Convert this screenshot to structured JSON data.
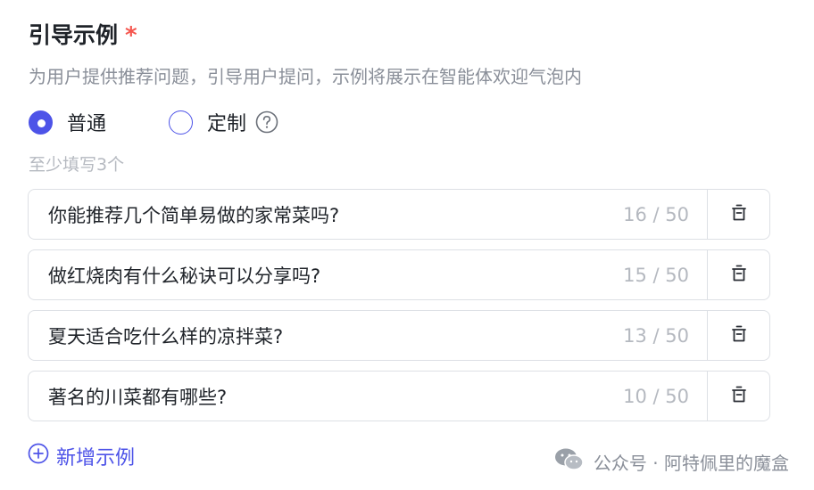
{
  "section": {
    "title": "引导示例",
    "required_mark": "*",
    "description": "为用户提供推荐问题，引导用户提问，示例将展示在智能体欢迎气泡内"
  },
  "mode": {
    "options": [
      {
        "label": "普通",
        "checked": true
      },
      {
        "label": "定制",
        "checked": false
      }
    ]
  },
  "hint": "至少填写3个",
  "examples": [
    {
      "text": "你能推荐几个简单易做的家常菜吗?",
      "count": "16 / 50"
    },
    {
      "text": "做红烧肉有什么秘诀可以分享吗?",
      "count": "15 / 50"
    },
    {
      "text": "夏天适合吃什么样的凉拌菜?",
      "count": "13 / 50"
    },
    {
      "text": "著名的川菜都有哪些?",
      "count": "10 / 50"
    }
  ],
  "add_button": {
    "label": "新增示例",
    "icon": "plus-circle-icon"
  },
  "watermark": {
    "text": "公众号 · 阿特佩里的魔盒",
    "icon": "wechat-icon"
  },
  "colors": {
    "accent": "#4d53e8",
    "required": "#f5574f",
    "muted": "#b5b9c0",
    "secondary": "#8a8f99"
  }
}
